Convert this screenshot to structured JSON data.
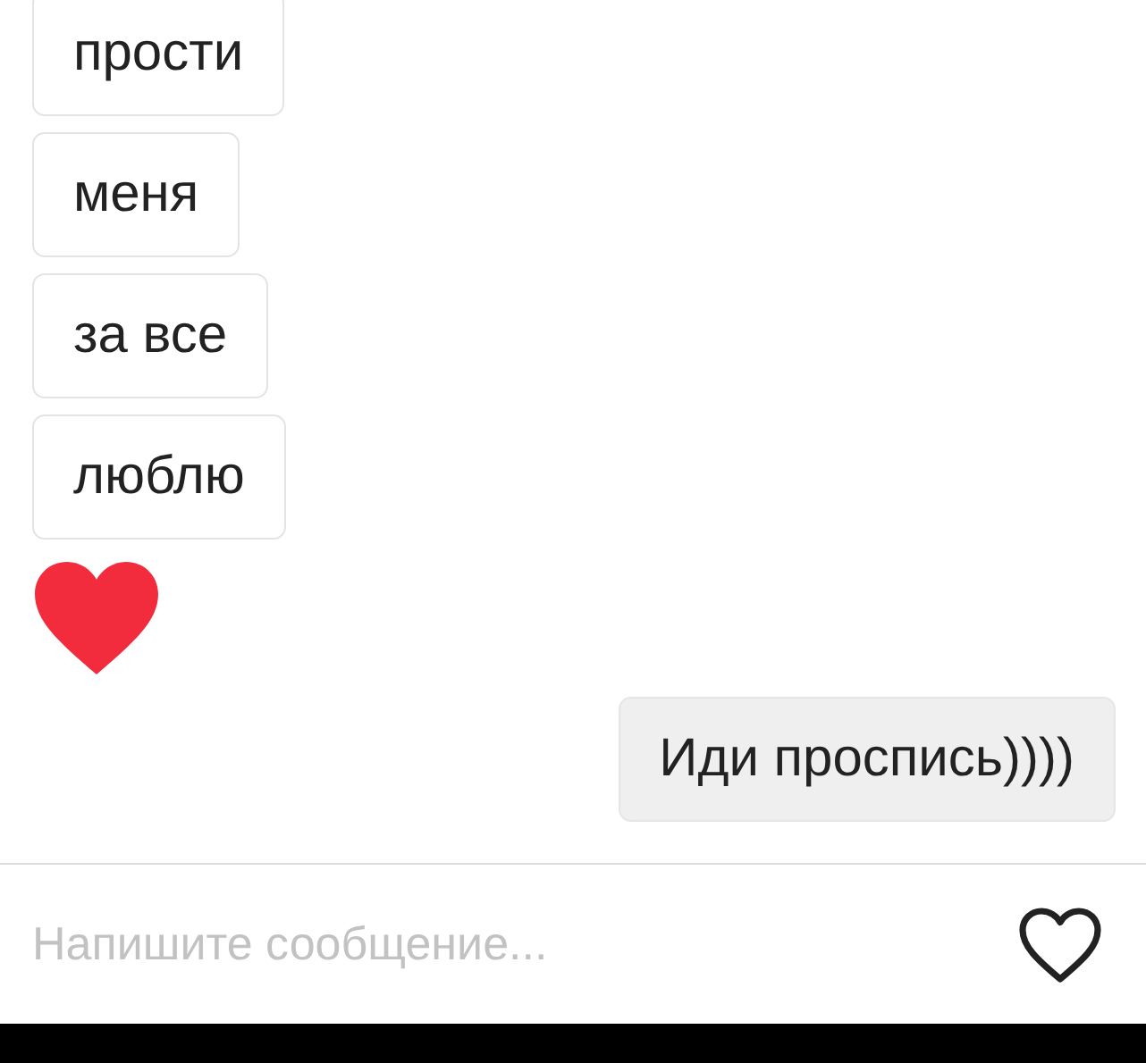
{
  "messages": [
    {
      "kind": "text",
      "outgoing": false,
      "text": "прости"
    },
    {
      "kind": "text",
      "outgoing": false,
      "text": "меня"
    },
    {
      "kind": "text",
      "outgoing": false,
      "text": "за все"
    },
    {
      "kind": "text",
      "outgoing": false,
      "text": "люблю"
    },
    {
      "kind": "heart",
      "outgoing": false
    },
    {
      "kind": "text",
      "outgoing": true,
      "text": "Иди проспись))))"
    }
  ],
  "composer": {
    "placeholder": "Напишите сообщение..."
  }
}
